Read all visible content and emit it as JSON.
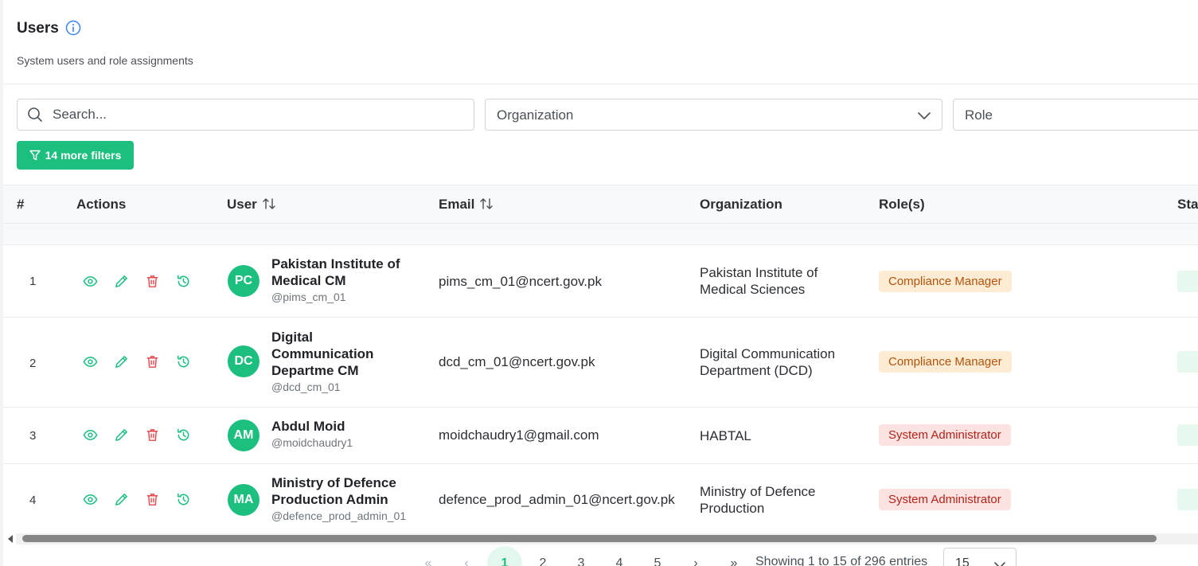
{
  "header": {
    "title": "Users",
    "subtitle": "System users and role assignments"
  },
  "filters": {
    "search_placeholder": "Search...",
    "organization_label": "Organization",
    "role_label": "Role",
    "more_filters_label": "14 more filters"
  },
  "table": {
    "columns": [
      "#",
      "Actions",
      "User",
      "Email",
      "Organization",
      "Role(s)",
      "Status"
    ],
    "rows": [
      {
        "index": "1",
        "initials": "PC",
        "name": "Pakistan Institute of Medical CM",
        "handle": "@pims_cm_01",
        "email": "pims_cm_01@ncert.gov.pk",
        "organization": "Pakistan Institute of Medical Sciences",
        "role": "Compliance Manager"
      },
      {
        "index": "2",
        "initials": "DC",
        "name": "Digital Communication Departme CM",
        "handle": "@dcd_cm_01",
        "email": "dcd_cm_01@ncert.gov.pk",
        "organization": "Digital Communication Department (DCD)",
        "role": "Compliance Manager"
      },
      {
        "index": "3",
        "initials": "AM",
        "name": "Abdul Moid",
        "handle": "@moidchaudry1",
        "email": "moidchaudry1@gmail.com",
        "organization": "HABTAL",
        "role": "System Administrator"
      },
      {
        "index": "4",
        "initials": "MA",
        "name": "Ministry of Defence Production Admin",
        "handle": "@defence_prod_admin_01",
        "email": "defence_prod_admin_01@ncert.gov.pk",
        "organization": "Ministry of Defence Production",
        "role": "System Administrator"
      }
    ]
  },
  "pagination": {
    "pages": [
      "1",
      "2",
      "3",
      "4",
      "5"
    ],
    "current": "1",
    "showing_text": "Showing 1 to 15 of 296 entries",
    "page_size": "15"
  },
  "colors": {
    "accent": "#1cbf7e",
    "view_icon": "#1cbf7e",
    "delete_icon": "#e5484d",
    "compliance_badge_bg": "#fdebd3",
    "admin_badge_bg": "#fde2e2"
  },
  "icons": [
    "info-icon",
    "search-icon",
    "chevron-down-icon",
    "filter-icon",
    "sort-icon",
    "eye-icon",
    "pencil-icon",
    "trash-icon",
    "history-icon"
  ]
}
